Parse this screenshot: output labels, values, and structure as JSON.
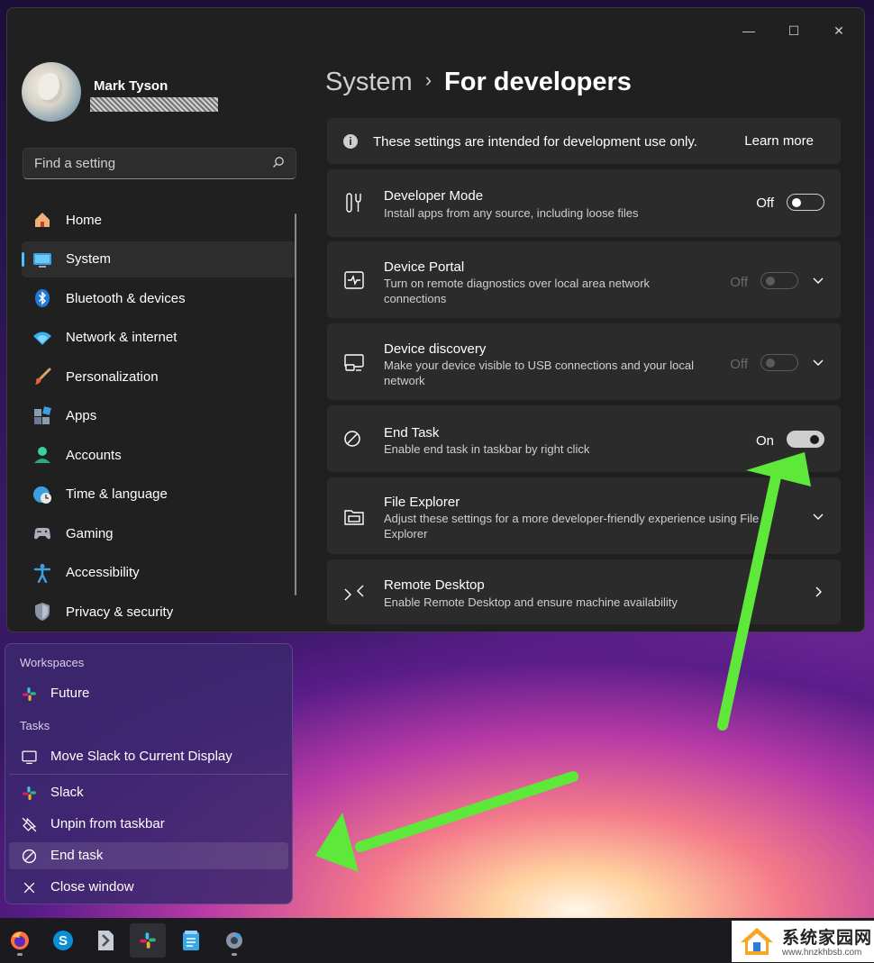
{
  "window": {
    "controls": {
      "minimize": "—",
      "maximize": "☐",
      "close": "✕"
    }
  },
  "profile": {
    "name": "Mark Tyson",
    "email": "redacted-email"
  },
  "search": {
    "placeholder": "Find a setting"
  },
  "nav": {
    "items": [
      {
        "label": "Home",
        "icon": "home-icon"
      },
      {
        "label": "System",
        "icon": "system-icon",
        "selected": true
      },
      {
        "label": "Bluetooth & devices",
        "icon": "bluetooth-icon"
      },
      {
        "label": "Network & internet",
        "icon": "wifi-icon"
      },
      {
        "label": "Personalization",
        "icon": "brush-icon"
      },
      {
        "label": "Apps",
        "icon": "apps-icon"
      },
      {
        "label": "Accounts",
        "icon": "accounts-icon"
      },
      {
        "label": "Time & language",
        "icon": "globe-clock-icon"
      },
      {
        "label": "Gaming",
        "icon": "gamepad-icon"
      },
      {
        "label": "Accessibility",
        "icon": "accessibility-icon"
      },
      {
        "label": "Privacy & security",
        "icon": "shield-icon"
      }
    ]
  },
  "breadcrumb": {
    "parent": "System",
    "separator": "›",
    "current": "For developers"
  },
  "info": {
    "text": "These settings are intended for development use only.",
    "link": "Learn more"
  },
  "settings": {
    "developer_mode": {
      "title": "Developer Mode",
      "desc": "Install apps from any source, including loose files",
      "state": "Off"
    },
    "device_portal": {
      "title": "Device Portal",
      "desc": "Turn on remote diagnostics over local area network connections",
      "state": "Off"
    },
    "device_discovery": {
      "title": "Device discovery",
      "desc": "Make your device visible to USB connections and your local network",
      "state": "Off"
    },
    "end_task": {
      "title": "End Task",
      "desc": "Enable end task in taskbar by right click",
      "state": "On"
    },
    "file_explorer": {
      "title": "File Explorer",
      "desc": "Adjust these settings for a more developer-friendly experience using File Explorer"
    },
    "remote_desktop": {
      "title": "Remote Desktop",
      "desc": "Enable Remote Desktop and ensure machine availability"
    }
  },
  "jumplist": {
    "workspaces_header": "Workspaces",
    "workspace": "Future",
    "tasks_header": "Tasks",
    "move_display": "Move Slack to Current Display",
    "slack": "Slack",
    "unpin": "Unpin from taskbar",
    "end_task": "End task",
    "close_window": "Close window"
  },
  "taskbar": {
    "apps": [
      "firefox-icon",
      "skype-icon",
      "file-icon",
      "slack-icon",
      "notepad-icon",
      "settings-gear-icon"
    ]
  },
  "watermark": {
    "cn": "系统家园网",
    "url": "www.hnzkhbsb.com"
  },
  "colors": {
    "accent": "#4cc2ff",
    "arrow": "#5ee83a",
    "window_bg": "#202020",
    "card_bg": "#2b2b2b"
  }
}
